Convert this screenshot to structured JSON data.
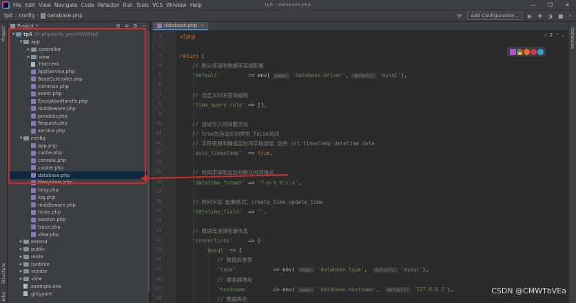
{
  "menu": [
    "File",
    "Edit",
    "View",
    "Navigate",
    "Code",
    "Refactor",
    "Run",
    "Tools",
    "VCS",
    "Window",
    "Help"
  ],
  "window_title": "tp6 - database.php",
  "window_controls": [
    "—",
    "❐",
    "✕"
  ],
  "breadcrumb": [
    "tp6",
    "config",
    "database.php"
  ],
  "nav_right": {
    "add_config": "Add Configuration..."
  },
  "left_tabs": {
    "project": "Project",
    "structure": "Structure",
    "bookmarks": "arks"
  },
  "right_tabs": {
    "database": "Database"
  },
  "project_panel": {
    "label": "Project",
    "tools": [
      "⊕",
      "≑",
      "⚙",
      "−"
    ]
  },
  "tree": [
    {
      "indent": 0,
      "arrow": "▼",
      "icon": "folder",
      "label": "tp6",
      "path": "D:\\phpstudy_pro\\WWW\\tp6"
    },
    {
      "indent": 1,
      "arrow": "▼",
      "icon": "folder",
      "label": "app"
    },
    {
      "indent": 2,
      "arrow": "▶",
      "icon": "folder",
      "label": "controller"
    },
    {
      "indent": 2,
      "arrow": "▶",
      "icon": "folder",
      "label": "view"
    },
    {
      "indent": 2,
      "arrow": "",
      "icon": "txt",
      "label": ".htaccess"
    },
    {
      "indent": 2,
      "arrow": "",
      "icon": "php",
      "label": "AppService.php"
    },
    {
      "indent": 2,
      "arrow": "",
      "icon": "php",
      "label": "BaseController.php"
    },
    {
      "indent": 2,
      "arrow": "",
      "icon": "php",
      "label": "common.php"
    },
    {
      "indent": 2,
      "arrow": "",
      "icon": "php",
      "label": "event.php"
    },
    {
      "indent": 2,
      "arrow": "",
      "icon": "php",
      "label": "ExceptionHandle.php"
    },
    {
      "indent": 2,
      "arrow": "",
      "icon": "php",
      "label": "middleware.php"
    },
    {
      "indent": 2,
      "arrow": "",
      "icon": "php",
      "label": "provider.php"
    },
    {
      "indent": 2,
      "arrow": "",
      "icon": "php",
      "label": "Request.php"
    },
    {
      "indent": 2,
      "arrow": "",
      "icon": "php",
      "label": "service.php"
    },
    {
      "indent": 1,
      "arrow": "▼",
      "icon": "folder",
      "label": "config"
    },
    {
      "indent": 2,
      "arrow": "",
      "icon": "php",
      "label": "app.php"
    },
    {
      "indent": 2,
      "arrow": "",
      "icon": "php",
      "label": "cache.php"
    },
    {
      "indent": 2,
      "arrow": "",
      "icon": "php",
      "label": "console.php"
    },
    {
      "indent": 2,
      "arrow": "",
      "icon": "php",
      "label": "cookie.php"
    },
    {
      "indent": 2,
      "arrow": "",
      "icon": "php",
      "label": "database.php",
      "selected": true
    },
    {
      "indent": 2,
      "arrow": "",
      "icon": "php",
      "label": "filesystem.php"
    },
    {
      "indent": 2,
      "arrow": "",
      "icon": "php",
      "label": "lang.php"
    },
    {
      "indent": 2,
      "arrow": "",
      "icon": "php",
      "label": "log.php"
    },
    {
      "indent": 2,
      "arrow": "",
      "icon": "php",
      "label": "middleware.php"
    },
    {
      "indent": 2,
      "arrow": "",
      "icon": "php",
      "label": "route.php"
    },
    {
      "indent": 2,
      "arrow": "",
      "icon": "php",
      "label": "session.php"
    },
    {
      "indent": 2,
      "arrow": "",
      "icon": "php",
      "label": "trace.php"
    },
    {
      "indent": 2,
      "arrow": "",
      "icon": "php",
      "label": "view.php"
    },
    {
      "indent": 1,
      "arrow": "▶",
      "icon": "folder",
      "label": "extend"
    },
    {
      "indent": 1,
      "arrow": "▶",
      "icon": "folder",
      "label": "public"
    },
    {
      "indent": 1,
      "arrow": "▶",
      "icon": "folder",
      "label": "route"
    },
    {
      "indent": 1,
      "arrow": "▶",
      "icon": "folder",
      "label": "runtime"
    },
    {
      "indent": 1,
      "arrow": "▶",
      "icon": "folder",
      "label": "vendor"
    },
    {
      "indent": 1,
      "arrow": "▶",
      "icon": "folder",
      "label": "view"
    },
    {
      "indent": 1,
      "arrow": "",
      "icon": "txt",
      "label": ".example.env"
    },
    {
      "indent": 1,
      "arrow": "",
      "icon": "txt",
      "label": ".gitignore"
    }
  ],
  "editor_tab": {
    "label": "database.php",
    "close": "×"
  },
  "inspection": {
    "check": "✓",
    "count": "2"
  },
  "code_lines": [
    [
      {
        "t": "kw",
        "v": "<?php"
      }
    ],
    [],
    [
      {
        "t": "kw",
        "v": "return "
      },
      {
        "t": "pl",
        "v": "["
      }
    ],
    [
      {
        "t": "cm",
        "v": "    // 默认使用的数据库连接配置"
      }
    ],
    [
      {
        "t": "str",
        "v": "    'default'"
      },
      {
        "t": "pl",
        "v": "         => env( "
      },
      {
        "t": "hint",
        "v": "name:"
      },
      {
        "t": "str",
        "v": " 'database.driver'"
      },
      {
        "t": "pl",
        "v": ", "
      },
      {
        "t": "hint",
        "v": "default:"
      },
      {
        "t": "str",
        "v": " 'mysql'"
      },
      {
        "t": "pl",
        "v": "),"
      }
    ],
    [],
    [
      {
        "t": "cm",
        "v": "    // 自定义时间查询规则"
      }
    ],
    [
      {
        "t": "str",
        "v": "    'time_query_rule'"
      },
      {
        "t": "pl",
        "v": " => [],"
      }
    ],
    [],
    [
      {
        "t": "cm",
        "v": "    // 自动写入时间戳字段"
      }
    ],
    [
      {
        "t": "cm",
        "v": "    // true为自动识别类型 false关闭"
      }
    ],
    [
      {
        "t": "cm",
        "v": "    // 字符串则明确指定时间字段类型 支持 int timestamp datetime date"
      }
    ],
    [
      {
        "t": "str",
        "v": "    'auto_timestamp'"
      },
      {
        "t": "pl",
        "v": "  => "
      },
      {
        "t": "kw",
        "v": "true"
      },
      {
        "t": "pl",
        "v": ","
      }
    ],
    [],
    [
      {
        "t": "cm",
        "v": "    // 时间字段取出后的默认时间格式"
      }
    ],
    [
      {
        "t": "str",
        "v": "    'datetime_format'"
      },
      {
        "t": "pl",
        "v": " => "
      },
      {
        "t": "str",
        "v": "'Y-m-d H:i:s'"
      },
      {
        "t": "pl",
        "v": ","
      }
    ],
    [],
    [
      {
        "t": "cm",
        "v": "    // 时间字段 配置格式：create_time,update_time"
      }
    ],
    [
      {
        "t": "str",
        "v": "    'datetime_field'"
      },
      {
        "t": "pl",
        "v": "  => "
      },
      {
        "t": "str",
        "v": "''"
      },
      {
        "t": "pl",
        "v": ","
      }
    ],
    [],
    [
      {
        "t": "cm",
        "v": "    // 数据库连接配置信息"
      }
    ],
    [
      {
        "t": "str",
        "v": "    'connections'"
      },
      {
        "t": "pl",
        "v": "     => ["
      }
    ],
    [
      {
        "t": "str",
        "v": "        'mysql'"
      },
      {
        "t": "pl",
        "v": " => ["
      }
    ],
    [
      {
        "t": "cm",
        "v": "            // 数据库类型"
      }
    ],
    [
      {
        "t": "str",
        "v": "            'type'"
      },
      {
        "t": "pl",
        "v": "            => env( "
      },
      {
        "t": "hint",
        "v": "name:"
      },
      {
        "t": "str",
        "v": " 'database.type'"
      },
      {
        "t": "pl",
        "v": ",  "
      },
      {
        "t": "hint",
        "v": "default:"
      },
      {
        "t": "str",
        "v": " 'mysql'"
      },
      {
        "t": "pl",
        "v": "),"
      }
    ],
    [
      {
        "t": "cm",
        "v": "            // 服务器地址"
      }
    ],
    [
      {
        "t": "str",
        "v": "            'hostname'"
      },
      {
        "t": "pl",
        "v": "        => env( "
      },
      {
        "t": "hint",
        "v": "name:"
      },
      {
        "t": "str",
        "v": " 'database.hostname'"
      },
      {
        "t": "pl",
        "v": ",  "
      },
      {
        "t": "hint",
        "v": "default:"
      },
      {
        "t": "str",
        "v": " '127.0.0.1'"
      },
      {
        "t": "pl",
        "v": "),"
      }
    ],
    [
      {
        "t": "cm",
        "v": "            // 数据库名"
      }
    ]
  ],
  "line_numbers": [
    "1",
    "2",
    "3",
    "4",
    "5",
    "6",
    "7",
    "8",
    "9",
    "10",
    "11",
    "12",
    "13",
    "14",
    "15",
    "16",
    "17",
    "18",
    "19",
    "20",
    "21",
    "22",
    "23",
    "24",
    "25",
    "26",
    "27",
    "28"
  ],
  "watermark": "CSDN @CMWTbVEa",
  "colors": {
    "highlight": "#d42a2a",
    "accent": "#4a88c7"
  }
}
